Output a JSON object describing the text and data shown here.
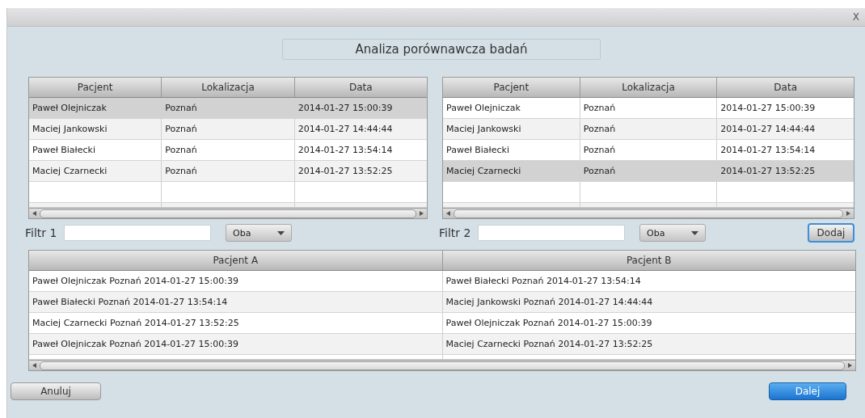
{
  "window": {
    "close_label": "X"
  },
  "heading": "Analiza porównawcza badań",
  "tables": [
    {
      "columns": [
        "Pacjent",
        "Lokalizacja",
        "Data"
      ],
      "rows": [
        {
          "cells": [
            "Paweł Olejniczak",
            "Poznań",
            "2014-01-27 15:00:39"
          ],
          "selected": true
        },
        {
          "cells": [
            "Maciej Jankowski",
            "Poznań",
            "2014-01-27 14:44:44"
          ],
          "selected": false
        },
        {
          "cells": [
            "Paweł Białecki",
            "Poznań",
            "2014-01-27 13:54:14"
          ],
          "selected": false
        },
        {
          "cells": [
            "Maciej Czarnecki",
            "Poznań",
            "2014-01-27 13:52:25"
          ],
          "selected": false
        }
      ]
    },
    {
      "columns": [
        "Pacjent",
        "Lokalizacja",
        "Data"
      ],
      "rows": [
        {
          "cells": [
            "Paweł Olejniczak",
            "Poznań",
            "2014-01-27 15:00:39"
          ],
          "selected": false
        },
        {
          "cells": [
            "Maciej Jankowski",
            "Poznań",
            "2014-01-27 14:44:44"
          ],
          "selected": false
        },
        {
          "cells": [
            "Paweł Białecki",
            "Poznań",
            "2014-01-27 13:54:14"
          ],
          "selected": false
        },
        {
          "cells": [
            "Maciej Czarnecki",
            "Poznań",
            "2014-01-27 13:52:25"
          ],
          "selected": true
        }
      ]
    }
  ],
  "filters": [
    {
      "label": "Filtr 1",
      "dropdown": "Oba"
    },
    {
      "label": "Filtr 2",
      "dropdown": "Oba"
    }
  ],
  "add_button": {
    "label": "Dodaj",
    "focused": true
  },
  "pairs_table": {
    "columns": [
      "Pacjent A",
      "Pacjent B"
    ],
    "rows": [
      {
        "cells": [
          "Paweł Olejniczak Poznań 2014-01-27 15:00:39",
          "Paweł Białecki Poznań 2014-01-27 13:54:14"
        ]
      },
      {
        "cells": [
          "Paweł Białecki Poznań 2014-01-27 13:54:14",
          "Maciej Jankowski Poznań 2014-01-27 14:44:44"
        ]
      },
      {
        "cells": [
          "Maciej Czarnecki Poznań 2014-01-27 13:52:25",
          "Paweł Olejniczak Poznań 2014-01-27 15:00:39"
        ]
      },
      {
        "cells": [
          "Paweł Olejniczak Poznań 2014-01-27 15:00:39",
          "Maciej Czarnecki Poznań 2014-01-27 13:52:25"
        ]
      }
    ]
  },
  "buttons": [
    {
      "label": "Anuluj",
      "kind": "secondary"
    },
    {
      "label": "Dalej",
      "kind": "primary"
    }
  ]
}
